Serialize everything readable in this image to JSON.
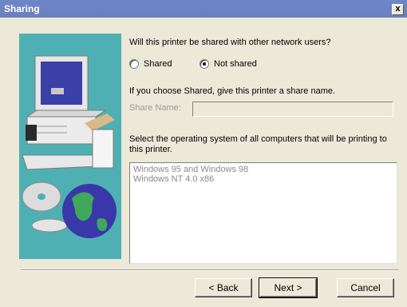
{
  "window": {
    "title": "Sharing",
    "close_label": "x"
  },
  "question": "Will this printer be shared with other network users?",
  "share_options": [
    {
      "label": "Shared",
      "selected": false
    },
    {
      "label": "Not shared",
      "selected": true
    }
  ],
  "share_name": {
    "instruction": "If you choose Shared, give this printer a share name.",
    "label": "Share Name:",
    "value": ""
  },
  "os_section": {
    "instruction_line1": "Select the operating system of all computers that will be printing to",
    "instruction_line2": "this printer.",
    "items": [
      "Windows 95 and Windows 98",
      "Windows NT 4.0 x86"
    ]
  },
  "buttons": {
    "back": "< Back",
    "next": "Next >",
    "cancel": "Cancel"
  },
  "colors": {
    "title_bar": "#6f86c6",
    "art_background": "#4fb0b4",
    "dialog": "#ece9d8"
  }
}
